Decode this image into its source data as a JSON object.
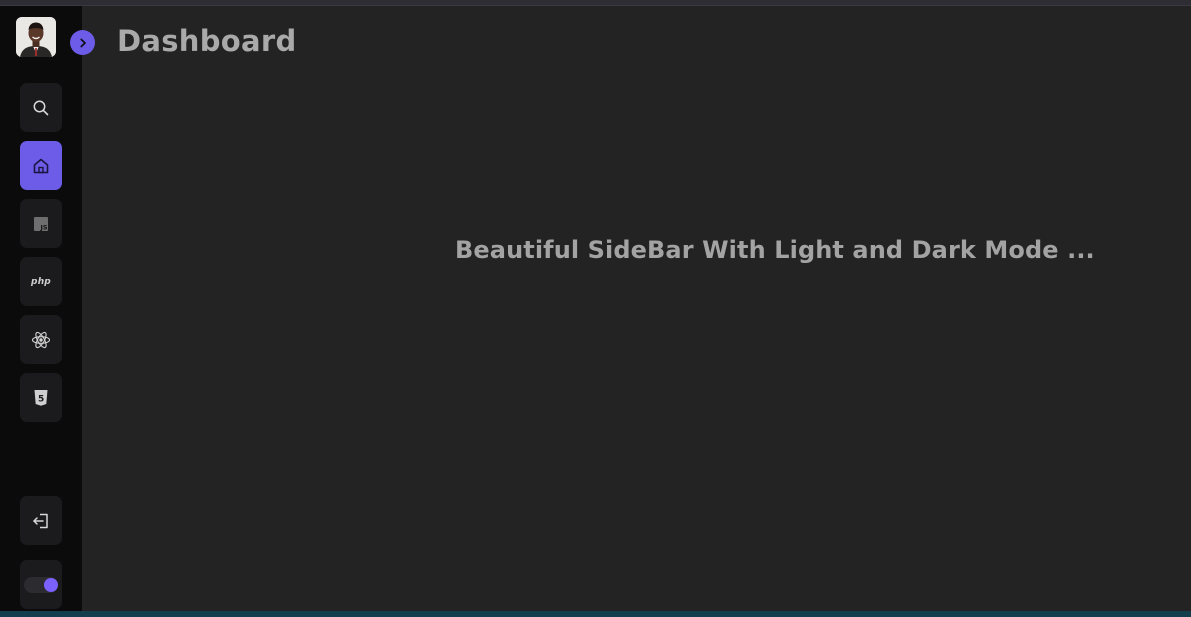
{
  "header": {
    "title": "Dashboard"
  },
  "main": {
    "hero_text": "Beautiful SideBar With Light and Dark Mode ..."
  },
  "sidebar": {
    "avatar_icon": "user-avatar",
    "expand_icon": "chevron-right-icon",
    "items": [
      {
        "icon": "search-icon",
        "active": false
      },
      {
        "icon": "home-icon",
        "active": true
      },
      {
        "icon": "js-icon",
        "label": "JS",
        "active": false
      },
      {
        "icon": "php-icon",
        "label": "php",
        "active": false
      },
      {
        "icon": "react-icon",
        "active": false
      },
      {
        "icon": "html5-icon",
        "label": "5",
        "active": false
      }
    ],
    "logout_icon": "logout-icon",
    "mode_switch": {
      "state": "on"
    }
  },
  "colors": {
    "accent": "#6c5ce7",
    "sidebar_bg": "#0b0b0c",
    "main_bg": "#232323",
    "text": "#a9a9a9"
  }
}
